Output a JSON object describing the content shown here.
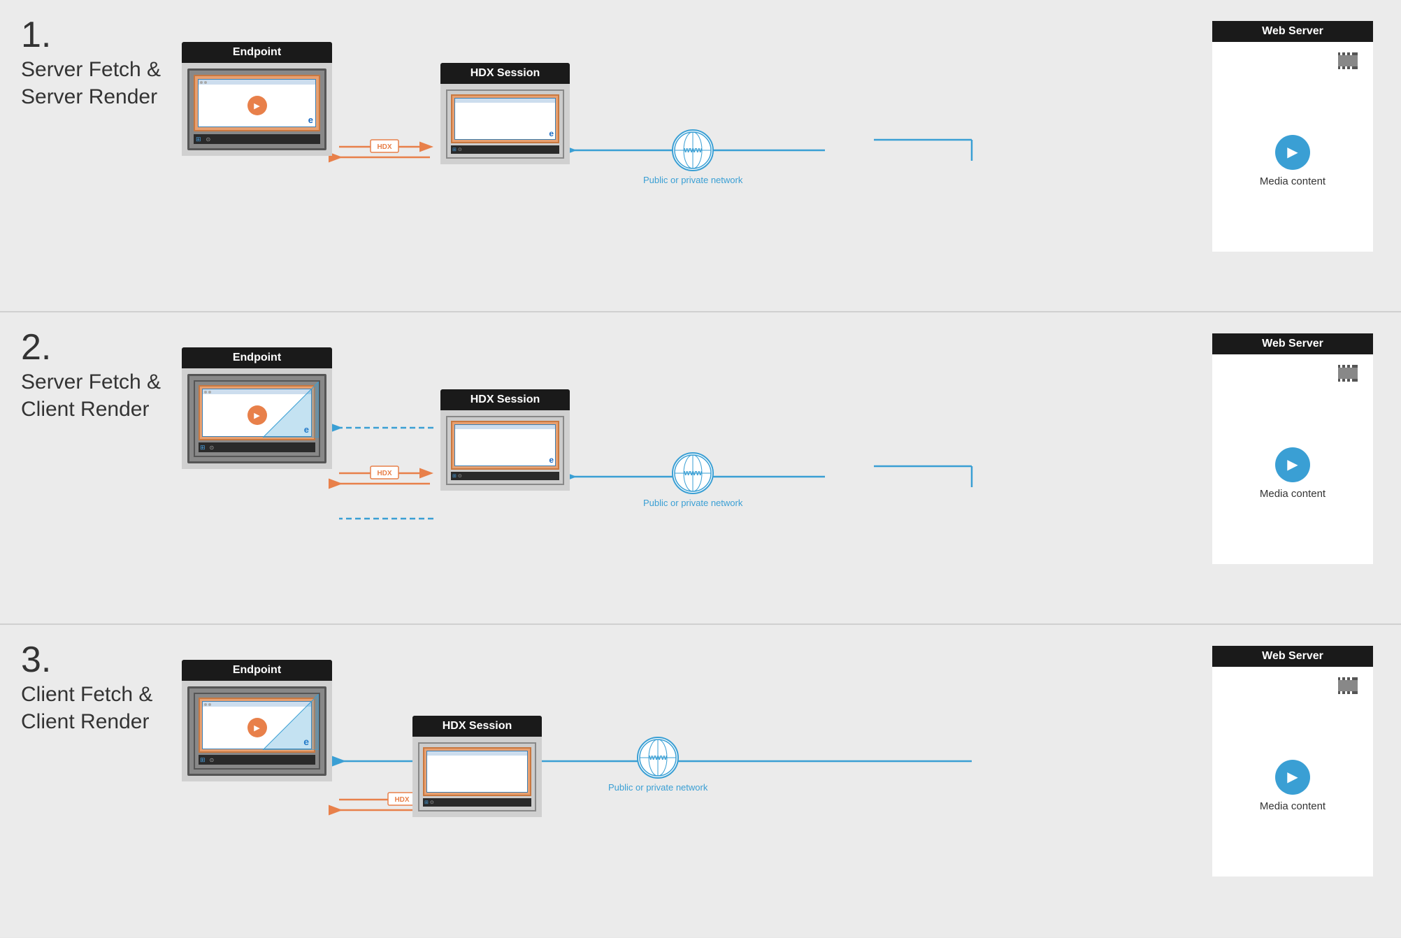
{
  "sections": [
    {
      "number": "1.",
      "label": "Server Fetch &\nServer Render",
      "endpoint_title": "Endpoint",
      "hdx_title": "HDX Session",
      "webserver_title": "Web Server",
      "media_label": "Media\ncontent",
      "network_label": "Public or private\nnetwork",
      "hdx_badge": "HDX"
    },
    {
      "number": "2.",
      "label": "Server Fetch &\nClient Render",
      "endpoint_title": "Endpoint",
      "hdx_title": "HDX Session",
      "webserver_title": "Web Server",
      "media_label": "Media\ncontent",
      "network_label": "Public or private\nnetwork",
      "hdx_badge": "HDX"
    },
    {
      "number": "3.",
      "label": "Client Fetch &\nClient Render",
      "endpoint_title": "Endpoint",
      "hdx_title": "HDX Session",
      "webserver_title": "Web Server",
      "media_label": "Media\ncontent",
      "network_label": "Public or private\nnetwork",
      "hdx_badge": "HDX"
    }
  ],
  "colors": {
    "orange": "#e8804a",
    "blue": "#3a9fd4",
    "dark": "#1a1a1a",
    "light_bg": "#ebebeb"
  }
}
